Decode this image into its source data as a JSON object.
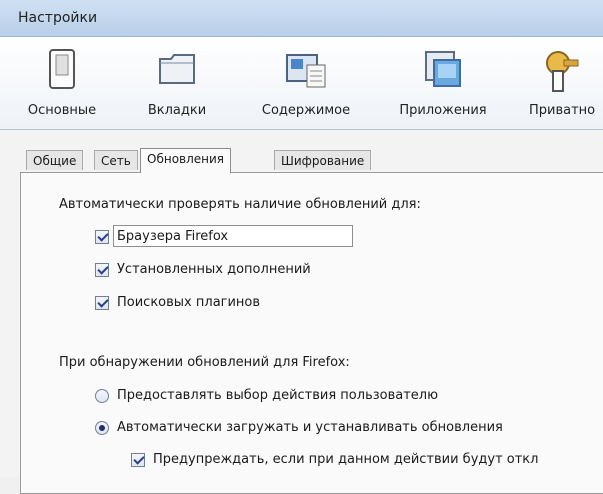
{
  "window": {
    "title": "Настройки"
  },
  "toolbar": {
    "items": [
      {
        "label": "Основные",
        "icon": "switch-icon"
      },
      {
        "label": "Вкладки",
        "icon": "folder-tabs-icon"
      },
      {
        "label": "Содержимое",
        "icon": "content-icon"
      },
      {
        "label": "Приложения",
        "icon": "applications-icon"
      },
      {
        "label": "Приватно",
        "icon": "key-icon"
      }
    ]
  },
  "tabs": [
    {
      "label": "Общие"
    },
    {
      "label": "Сеть"
    },
    {
      "label": "Обновления"
    },
    {
      "label": "Шифрование"
    }
  ],
  "auto_check": {
    "heading": "Автоматически проверять наличие обновлений для:",
    "items": [
      {
        "label": "Браузера Firefox",
        "checked": true
      },
      {
        "label": "Установленных дополнений",
        "checked": true
      },
      {
        "label": "Поисковых плагинов",
        "checked": true
      }
    ]
  },
  "on_update": {
    "heading": "При обнаружении обновлений для Firefox:",
    "options": [
      {
        "label": "Предоставлять выбор действия пользователю",
        "selected": false
      },
      {
        "label": "Автоматически загружать и устанавливать обновления",
        "selected": true
      }
    ],
    "sub_option": {
      "label": "Предупреждать, если при данном действии будут откл",
      "checked": true
    }
  }
}
